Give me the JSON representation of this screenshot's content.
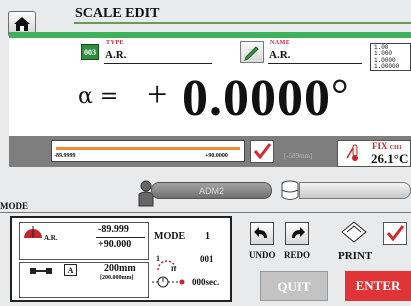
{
  "header": {
    "title": "SCALE EDIT"
  },
  "type": {
    "badge": "003",
    "caption": "TYPE",
    "value": "A.R."
  },
  "name": {
    "caption": "NAME",
    "value": "A.R."
  },
  "resolution": [
    "1.00",
    "1.000",
    "1.0000",
    "1.00000"
  ],
  "display": {
    "symbol": "α =",
    "sign": "+",
    "value": "0.0000",
    "unit": "°"
  },
  "range_slider": {
    "min_label": "-89.9999",
    "max_label": "+90.0000",
    "bar_color": "#f08a3c"
  },
  "disp_right": "[-589mm]",
  "temperature": {
    "label": "FIX",
    "channel": "CH1",
    "value": "26.1°C"
  },
  "user": {
    "label": "ADM2"
  },
  "mode_section": {
    "heading": "MODE"
  },
  "mode_panel": {
    "angle_label": "A.R.",
    "upper": "-89.999",
    "lower": "+90.000",
    "mode_label": "MODE",
    "mode_value": "1",
    "a_badge": "A",
    "length": "200mm",
    "length_range": "[200.000mm]",
    "count_value": "001",
    "time_value": "000sec."
  },
  "actions": {
    "undo": "UNDO",
    "redo": "REDO",
    "print": "PRINT",
    "quit": "QUIT",
    "enter": "ENTER"
  },
  "colors": {
    "accent_green": "#3bb25a",
    "enter_red": "#e03437",
    "check_red": "#d22a2f"
  }
}
